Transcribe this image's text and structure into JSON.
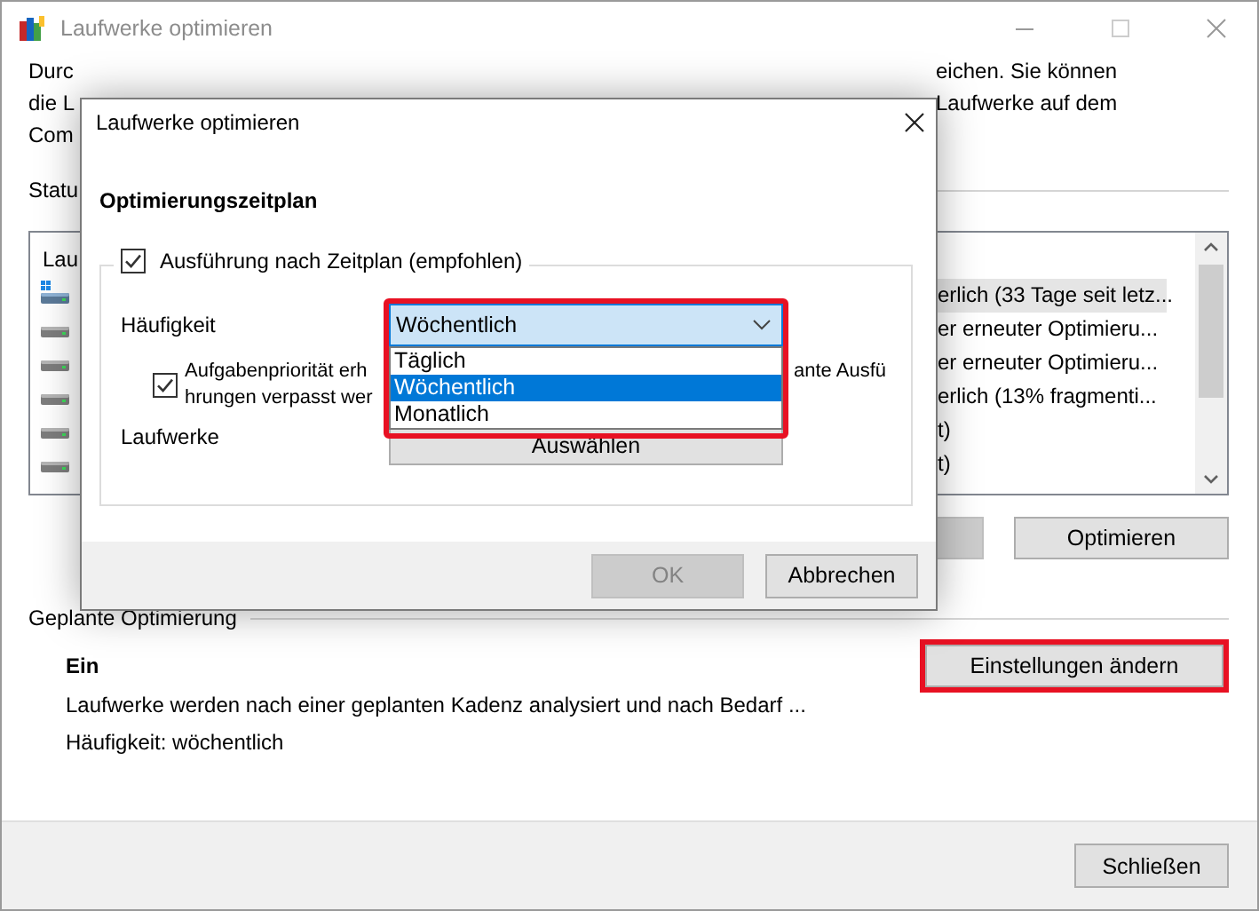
{
  "window": {
    "title": "Laufwerke optimieren"
  },
  "intro": [
    {
      "left": "Durc",
      "right": "eichen. Sie können"
    },
    {
      "left": "die L",
      "right": "Laufwerke auf dem"
    },
    {
      "left": "Com"
    }
  ],
  "status_label": "Statu",
  "drive_list": {
    "header": "Lau",
    "rows": [
      {
        "kind": "system",
        "status": "erlich (33 Tage seit letz...",
        "selected": true
      },
      {
        "kind": "disk",
        "status": "er erneuter Optimieru...",
        "selected": false
      },
      {
        "kind": "disk",
        "status": "er erneuter Optimieru...",
        "selected": false
      },
      {
        "kind": "disk",
        "status": "erlich (13% fragmenti...",
        "selected": false
      },
      {
        "kind": "disk",
        "status": "t)",
        "selected": false
      },
      {
        "kind": "disk",
        "status": "t)",
        "selected": false
      }
    ]
  },
  "optimize_button": "Optimieren",
  "schedule": {
    "heading": "Geplante Optimierung",
    "state": "Ein",
    "settings_button": {
      "label": "Einstellungen ändern",
      "highlighted": true
    },
    "description": "Laufwerke werden nach einer geplanten Kadenz analysiert und nach Bedarf ...",
    "frequency": "Häufigkeit: wöchentlich"
  },
  "close_button": "Schließen",
  "dialog": {
    "title": "Laufwerke optimieren",
    "heading": "Optimierungszeitplan",
    "run_on_schedule": {
      "label": "Ausführung nach Zeitplan (empfohlen)",
      "checked": true
    },
    "frequency": {
      "label": "Häufigkeit",
      "value": "Wöchentlich",
      "highlighted": true,
      "expanded": true,
      "options": [
        {
          "label": "Täglich",
          "selected": false
        },
        {
          "label": "Wöchentlich",
          "selected": true
        },
        {
          "label": "Monatlich",
          "selected": false
        }
      ]
    },
    "priority": {
      "checked": true,
      "lines": [
        {
          "left": "Aufgabenpriorität erh",
          "right": "ante Ausfü"
        },
        {
          "left": "hrungen verpasst wer"
        }
      ]
    },
    "drives": {
      "label": "Laufwerke",
      "button": "Auswählen"
    },
    "buttons": [
      {
        "label": "OK",
        "disabled": true
      },
      {
        "label": "Abbrechen",
        "disabled": false
      }
    ]
  }
}
